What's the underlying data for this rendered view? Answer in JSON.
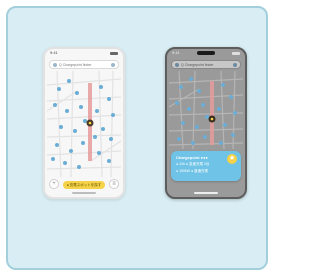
{
  "light_phone": {
    "time": "9:41",
    "search_placeholder": "Q  Chargepoint finder",
    "bottom_action": "● 充電スポットを探す"
  },
  "dark_phone": {
    "time": "9:41",
    "search_placeholder": "Q  Chargepoint finder",
    "info_card": {
      "title": "Chargepoint  ●●●",
      "line1": "● 24h    ● 急速充電  2台",
      "line2": "● 150kW  ● 普通充電"
    }
  },
  "colors": {
    "card_bg": "#d8eef4",
    "pin": "#6aaed6",
    "route": "#e79b9b",
    "accent_yellow": "#f5d247",
    "info_card": "#6fc3e6"
  },
  "icons": [
    "search-icon",
    "map-pin-icon",
    "location-marker-icon",
    "plus-icon",
    "star-icon",
    "signal-icon"
  ]
}
